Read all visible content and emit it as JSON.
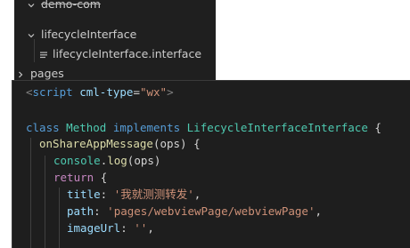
{
  "explorer": {
    "items": [
      {
        "label": "demo-com",
        "expanded": true
      },
      {
        "label": "lifecycleInterface",
        "expanded": true
      },
      {
        "label": "lifecycleInterface.interface",
        "icon": "lines-file-icon"
      },
      {
        "label": "pages",
        "expanded": false
      }
    ]
  },
  "editor": {
    "line1": {
      "open": "<",
      "tag": "script",
      "space": " ",
      "attr": "cml-type",
      "eq": "=",
      "value": "\"wx\"",
      "close": ">"
    },
    "line3": {
      "kw_class": "class",
      "name": "Method",
      "kw_impl": "implements",
      "iface": "LifecycleInterfaceInterface",
      "brace": "{"
    },
    "line4": {
      "fn": "onShareAppMessage",
      "params": "(ops) {"
    },
    "line5": {
      "obj": "console",
      "dot": ".",
      "fn": "log",
      "args": "(ops)"
    },
    "line6": {
      "kw": "return",
      "brace": "{"
    },
    "line7": {
      "key": "title",
      "colon": ":",
      "value": "'我就测测转发'",
      "comma": ","
    },
    "line8": {
      "key": "path",
      "colon": ":",
      "value": "'pages/webviewPage/webviewPage'",
      "comma": ","
    },
    "line9": {
      "key": "imageUrl",
      "colon": ":",
      "value": "''",
      "comma": ","
    }
  },
  "colors": {
    "editor_bg": "#1e1e1e",
    "keyword": "#569cd6",
    "string": "#ce9178",
    "type": "#4ec9b0",
    "function": "#dcdcaa",
    "property": "#9cdcfe"
  }
}
